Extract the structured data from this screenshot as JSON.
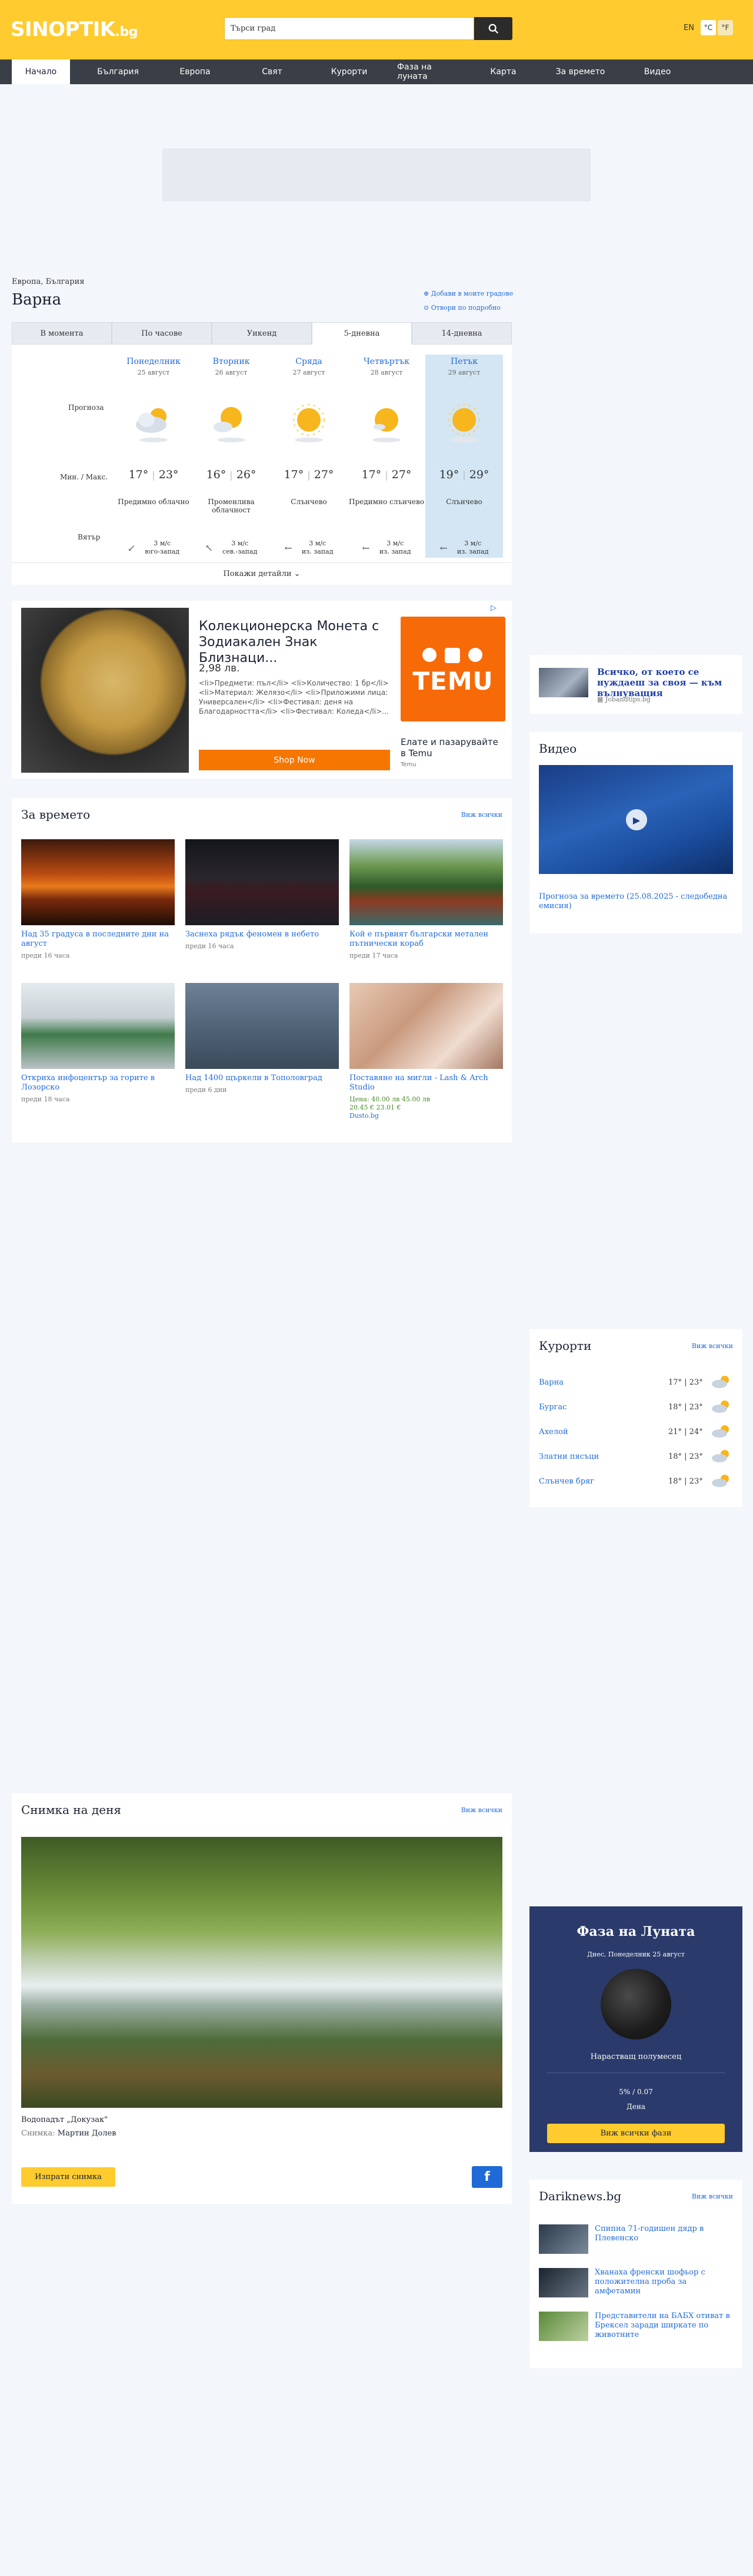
{
  "header": {
    "logo_main": "SINOPTIK",
    "logo_tld": ".bg",
    "search_placeholder": "Търси град",
    "lang": "EN",
    "unit_c": "°C",
    "unit_f": "°F",
    "colors": {
      "brand": "#ffcb2e",
      "nav": "#3a3e46",
      "link": "#1f6ad6"
    }
  },
  "nav": [
    "Начало",
    "България",
    "Европа",
    "Свят",
    "Курорти",
    "Фаза на луната",
    "Карта",
    "За времето",
    "Видео"
  ],
  "location": {
    "breadcrumb": "Европа, България",
    "city": "Варна",
    "add_favorites": "Добави в моите градове",
    "open_details": "Отвори по подробно"
  },
  "forecast": {
    "tabs": [
      "В момента",
      "По часове",
      "Уикенд",
      "5-дневна",
      "14-дневна"
    ],
    "active_tab": 3,
    "row_labels": {
      "forecast": "Прогноза",
      "minmax": "Мин. / Макс.",
      "wind": "Вятър"
    },
    "days": [
      {
        "name": "Понеделник",
        "date": "25 август",
        "min": "17°",
        "max": "23°",
        "desc": "Предимно облачно",
        "icon": "cloudy-sun-icon",
        "wind": "3 м/с",
        "wind_dir": "ЮЗ",
        "arrow": "↙",
        "wind_label": "3 м/с\nюго-запад"
      },
      {
        "name": "Вторник",
        "date": "26 август",
        "min": "16°",
        "max": "26°",
        "desc": "Променлива облачност",
        "icon": "partly-cloudy-icon",
        "arrow": "↖",
        "wind_label": "3 м/с\nсев.-запад"
      },
      {
        "name": "Сряда",
        "date": "27 август",
        "min": "17°",
        "max": "27°",
        "desc": "Слънчево",
        "icon": "sun-icon",
        "arrow": "←",
        "wind_label": "3 м/с\nиз. запад"
      },
      {
        "name": "Четвъртък",
        "date": "28 август",
        "min": "17°",
        "max": "27°",
        "desc": "Предимно слънчево",
        "icon": "mostly-sunny-icon",
        "arrow": "←",
        "wind_label": "3 м/с\nиз. запад"
      },
      {
        "name": "Петък",
        "date": "29 август",
        "min": "19°",
        "max": "29°",
        "desc": "Слънчево",
        "icon": "sun-icon",
        "arrow": "←",
        "wind_label": "3 м/с\nиз. запад"
      }
    ],
    "show_details": "Покажи детайли"
  },
  "ad": {
    "title": "Колекционерска Монета с Зодиакален Знак Близнаци...",
    "price": "2,98 лв.",
    "desc": "<li>Предмети: пъл</li> <li>Количество: 1 бр</li> <li>Материал: Желязо</li> <li>Приложими лица: Универсален</li> <li>Фестивал: деня на Благодарността</li> <li>Фестивал: Коледа</li>...",
    "shop": "Shop Now",
    "brand": "TEMU",
    "brand_caption": "Елате и пазарувайте в Temu",
    "brand_source": "Temu",
    "tag": "▷"
  },
  "weather_news": {
    "title": "За времето",
    "see_all": "Виж всички",
    "items": [
      {
        "title": "Над 35 градуса в последните дни на август",
        "ago": "преди 16 часа"
      },
      {
        "title": "Заснеха рядък феномен в небето",
        "ago": "преди 16 часа"
      },
      {
        "title": "Кой е първият български метален пътнически кораб",
        "ago": "преди 17 часа"
      },
      {
        "title": "Откриха инфоцентър за горите в Лозорско",
        "ago": "преди 18 часа"
      },
      {
        "title": "Над 1400 щъркели в Тополовград",
        "ago": "преди 6 дни"
      },
      {
        "title": "Поставяне на мигли - Lash & Arch Studio",
        "promo": "Цена: 40.00 лв 45.00 лв",
        "promo2": "20.45 € 23.01 €",
        "source": "Dusto.bg"
      }
    ]
  },
  "sidebar_ad": {
    "title": "Всичко, от което се нуждаеш за своя — към вълнуващия",
    "source": "Jobandtips.bg"
  },
  "video": {
    "title": "Видео",
    "caption": "Прогноза за времето (25.08.2025 - следобедна емисия)"
  },
  "resorts": {
    "title": "Курорти",
    "see_all": "Виж всички",
    "items": [
      {
        "name": "Варна",
        "temps": "17° | 23°"
      },
      {
        "name": "Бургас",
        "temps": "18° | 23°"
      },
      {
        "name": "Ахелой",
        "temps": "21° | 24°"
      },
      {
        "name": "Златни пясъци",
        "temps": "18° | 23°"
      },
      {
        "name": "Слънчев бряг",
        "temps": "18° | 23°"
      }
    ]
  },
  "photo_of_day": {
    "title": "Снимка на деня",
    "see_all": "Виж всички",
    "caption": "Водопадът „Докузак\"",
    "author_label": "Снимка:",
    "author": "Мартин Долев",
    "send": "Изпрати снимка",
    "fb": "f"
  },
  "moon": {
    "title": "Фаза на Луната",
    "date": "Днес, Понеделник 25 август",
    "phase": "Нарастващ полумесец",
    "pct": "5% / 0.07",
    "days": "Дена",
    "button": "Виж всички фази"
  },
  "darik": {
    "title": "Dariknews.bg",
    "see_all": "Виж всички",
    "items": [
      {
        "title": "Спипна 71-годишен дядр в Плевенско"
      },
      {
        "title": "Хванаха френски шофьор с положителна проба за амфетамин"
      },
      {
        "title": "Представители на БАБХ отиват в Брексел заради ширкате по животните"
      }
    ]
  }
}
